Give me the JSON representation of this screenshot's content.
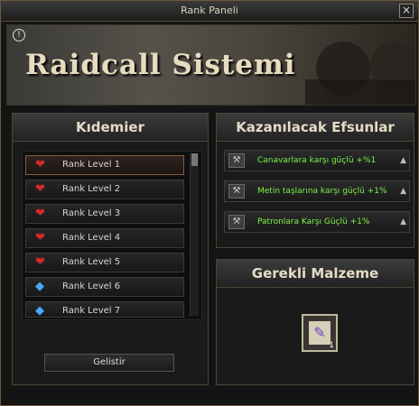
{
  "window": {
    "title": "Rank Paneli",
    "close_icon": "close-icon"
  },
  "banner": {
    "title": "Raidcall Sistemi",
    "info_glyph": "!"
  },
  "ranks_panel": {
    "heading": "Kıdemier",
    "items": [
      {
        "label": "Rank Level 1",
        "icon": "red-heart-icon",
        "color": "#d42a2a",
        "selected": true
      },
      {
        "label": "Rank Level 2",
        "icon": "red-heart-icon",
        "color": "#d42a2a"
      },
      {
        "label": "Rank Level 3",
        "icon": "red-heart-icon",
        "color": "#d42a2a"
      },
      {
        "label": "Rank Level 4",
        "icon": "red-heart-icon",
        "color": "#d42a2a"
      },
      {
        "label": "Rank Level 5",
        "icon": "red-heart-icon",
        "color": "#d42a2a"
      },
      {
        "label": "Rank Level 6",
        "icon": "blue-diamond-icon",
        "color": "#4aa8ff"
      },
      {
        "label": "Rank Level 7",
        "icon": "blue-diamond-icon",
        "color": "#4aa8ff"
      }
    ],
    "button_label": "Gelistir"
  },
  "bonuses_panel": {
    "heading": "Kazanılacak Efsunlar",
    "items": [
      {
        "text": "Canavarlara karşı güçlü +%1",
        "icon": "anvil-icon"
      },
      {
        "text": "Metin taşlarına karşı güçlü +1%",
        "icon": "anvil-icon"
      },
      {
        "text": "Patronlara Karşı Güçlü +1%",
        "icon": "anvil-icon"
      }
    ]
  },
  "materials_panel": {
    "heading": "Gerekli Malzeme",
    "item": {
      "icon": "scroll-icon",
      "count": "1"
    }
  },
  "colors": {
    "accent_gold": "#e6dcc6",
    "bonus_green": "#7cf24a",
    "window_border": "#6a5a3c"
  }
}
